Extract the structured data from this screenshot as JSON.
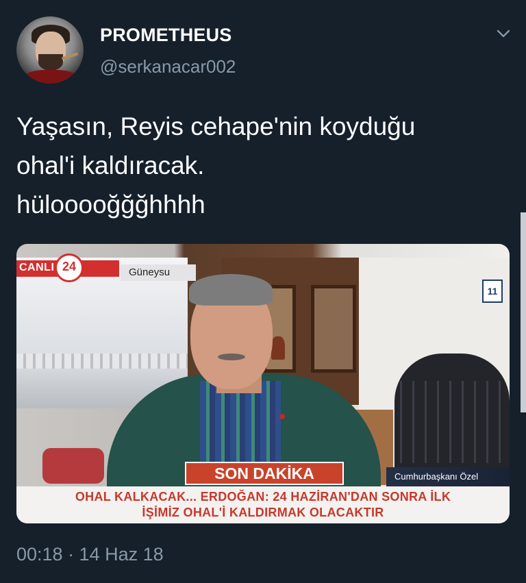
{
  "tweet": {
    "display_name": "PROMETHEUS",
    "handle": "@serkanacar002",
    "avatar_icon": "user-avatar-photo",
    "menu_icon": "chevron-down-icon",
    "text_lines": [
      "Yaşasın, Reyis cehape'nin koyduğu",
      "ohal'i kaldıracak.",
      "hülooooğğğhhhh"
    ],
    "timestamp": "00:18 · 14 Haz 18"
  },
  "media": {
    "channel_live_label": "CANLI",
    "channel_number": "24",
    "location": "Güneysu",
    "calendar_badge": "11",
    "breaking_label": "SON DAKİKA",
    "lower_third_right": "Cumhurbaşkanı Özel",
    "headline_lines": [
      "OHAL KALKACAK... ERDOĞAN: 24 HAZİRAN'DAN SONRA İLK",
      "İŞİMİZ OHAL'İ KALDIRMAK OLACAKTIR"
    ]
  },
  "colors": {
    "background": "#15202b",
    "secondary_text": "#8899a6",
    "breaking_red": "#c9432b",
    "headline_red": "#c8382a"
  }
}
